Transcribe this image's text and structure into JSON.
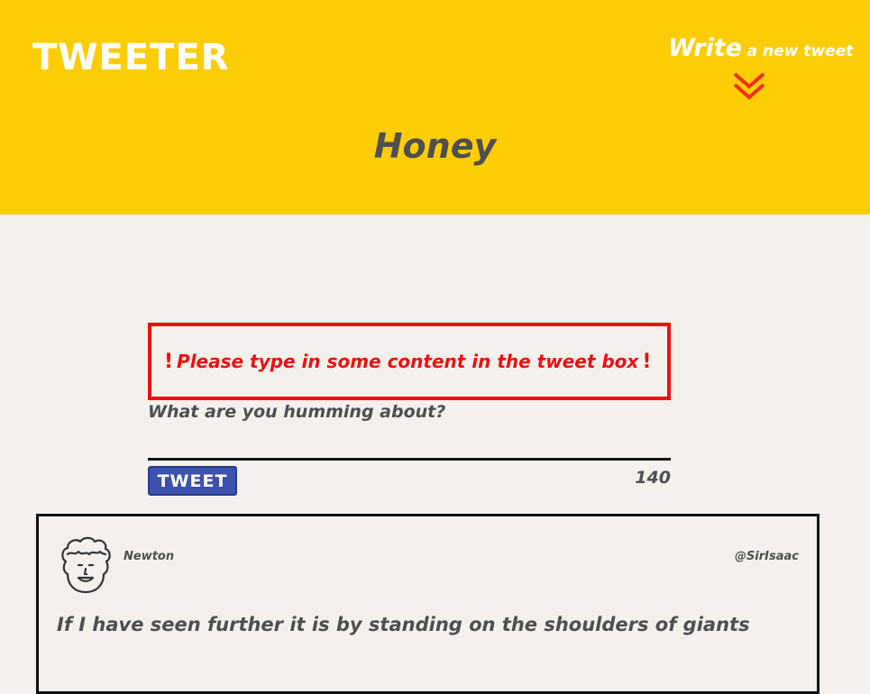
{
  "header": {
    "logo": "TWEETER",
    "compose_toggle": {
      "word": "Write",
      "rest": "a new tweet",
      "icon": "double-chevron-down-icon"
    },
    "page_title": "Honey"
  },
  "compose": {
    "error_message": "Please type in some content in the tweet box",
    "error_icon": "exclamation-icon",
    "error_icon_glyph": "!",
    "label": "What are you humming about?",
    "textarea_value": "",
    "button_label": "TWEET",
    "char_counter": "140"
  },
  "tweets": [
    {
      "avatar": "curly-hair-avatar-icon",
      "name": "Newton",
      "handle": "@SirIsaac",
      "text": "If I have seen further it is by standing on the shoulders of giants"
    }
  ],
  "colors": {
    "header_bg": "#fecd05",
    "page_bg": "#f4f1ec",
    "error": "#ef0f0f",
    "button": "#3d51ad",
    "text": "#4f4f4f",
    "chevron": "#f0301a"
  }
}
